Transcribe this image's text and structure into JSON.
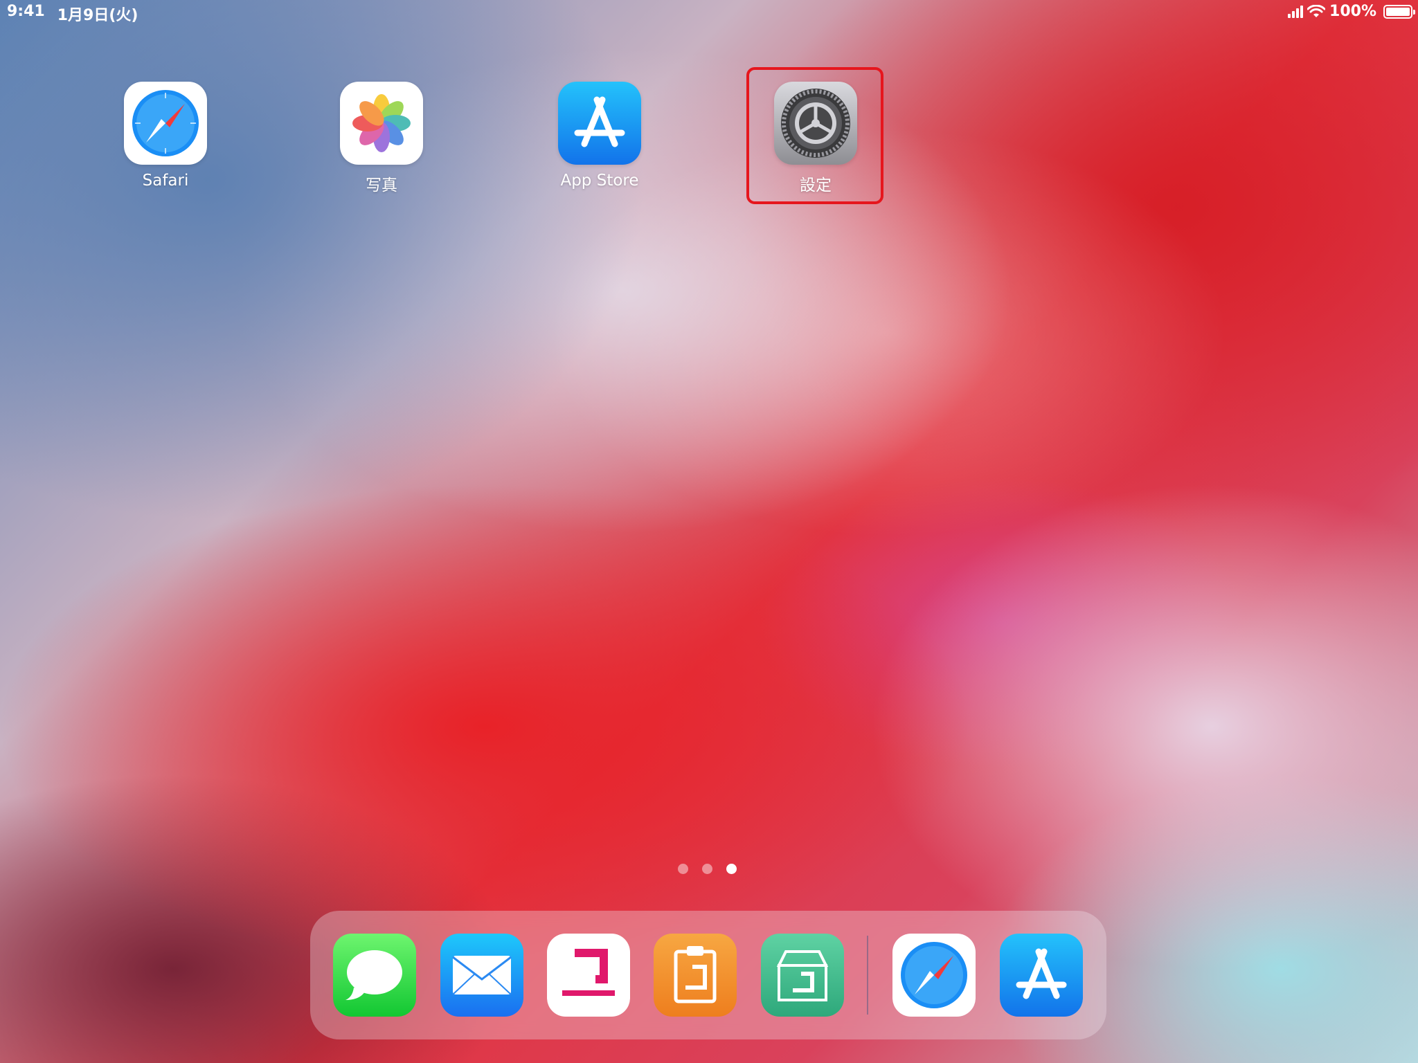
{
  "status_bar": {
    "time": "9:41",
    "date": "1月9日(火)",
    "battery_percent": "100%",
    "signal_icon": "cellular-signal-icon",
    "wifi_icon": "wifi-icon",
    "battery_icon": "battery-icon"
  },
  "home_apps": [
    {
      "label": "Safari",
      "icon": "safari-icon"
    },
    {
      "label": "写真",
      "icon": "photos-icon"
    },
    {
      "label": "App Store",
      "icon": "app-store-icon"
    },
    {
      "label": "設定",
      "icon": "settings-gear-icon"
    }
  ],
  "highlight": {
    "target": "設定",
    "color": "#e6161d"
  },
  "page_dots": {
    "count": 3,
    "active_index": 2
  },
  "dock": {
    "apps": [
      {
        "icon": "messages-icon"
      },
      {
        "icon": "mail-icon"
      },
      {
        "icon": "pink-bracket-app-icon"
      },
      {
        "icon": "orange-clipboard-app-icon"
      },
      {
        "icon": "green-box-app-icon"
      },
      {
        "icon": "safari-icon"
      },
      {
        "icon": "app-store-icon"
      }
    ]
  }
}
